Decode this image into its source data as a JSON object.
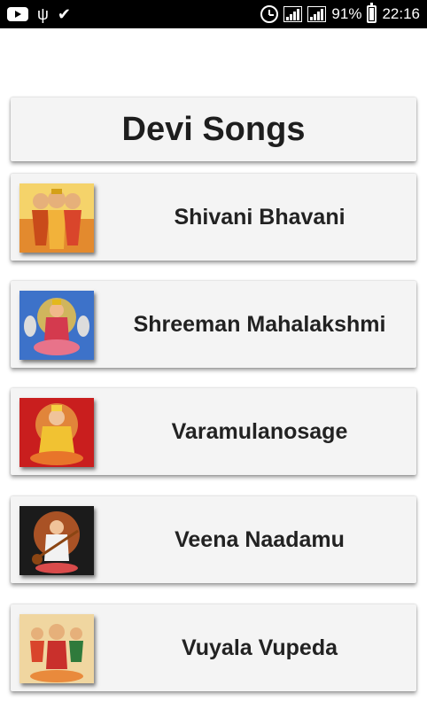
{
  "status_bar": {
    "icons_left": [
      "youtube-icon",
      "usb-icon",
      "check-icon"
    ],
    "battery": "91%",
    "time": "22:16"
  },
  "header": {
    "title": "Devi Songs"
  },
  "songs": [
    {
      "label": "Shivani Bhavani",
      "thumb_icon": "devi-image",
      "colors": [
        "#f2b23a",
        "#c94b1a"
      ]
    },
    {
      "label": "Shreeman Mahalakshmi",
      "thumb_icon": "lakshmi-image",
      "colors": [
        "#3d72c9",
        "#d43a4e"
      ]
    },
    {
      "label": "Varamulanosage",
      "thumb_icon": "lakshmi-image",
      "colors": [
        "#c91e1e",
        "#f1c232"
      ]
    },
    {
      "label": "Veena Naadamu",
      "thumb_icon": "saraswati-image",
      "colors": [
        "#1b1b1b",
        "#e56a2a"
      ]
    },
    {
      "label": "Vuyala Vupeda",
      "thumb_icon": "devi-image",
      "colors": [
        "#f0d6a0",
        "#d9452b"
      ]
    }
  ]
}
